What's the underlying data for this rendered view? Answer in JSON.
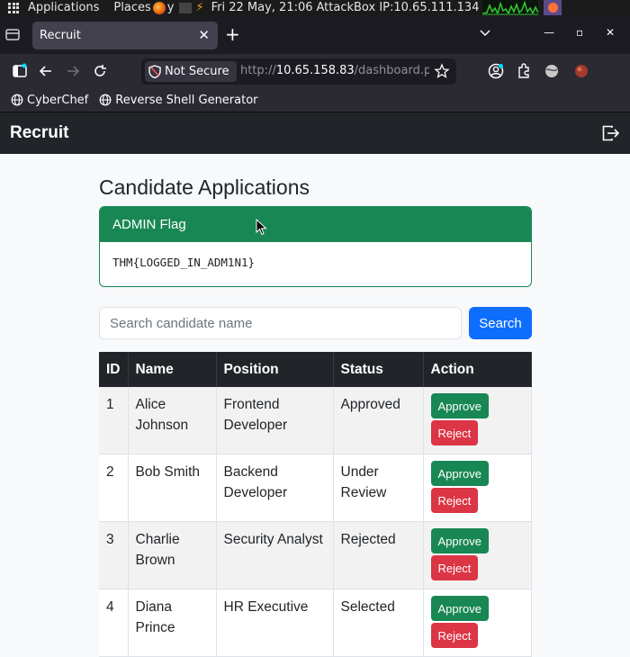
{
  "os_bar": {
    "applications_label": "Applications",
    "places_label": "Places",
    "firefox_fragment": "y",
    "clock": "Fri 22 May, 21:06",
    "ip_label": "AttackBox IP:10.65.111.134"
  },
  "browser": {
    "tab_title": "Recruit",
    "security_label": "Not Secure",
    "url_prefix": "http://",
    "url_host": "10.65.158.83",
    "url_path": "/dashboard.p",
    "bookmarks": [
      "CyberChef",
      "Reverse Shell Generator"
    ]
  },
  "site": {
    "brand": "Recruit",
    "page_title": "Candidate Applications",
    "flag_card": {
      "header": "ADMIN Flag",
      "value": "THM{LOGGED_IN_ADM1N1}"
    },
    "search": {
      "placeholder": "Search candidate name",
      "button_label": "Search"
    },
    "table": {
      "headers": [
        "ID",
        "Name",
        "Position",
        "Status",
        "Action"
      ],
      "rows": [
        {
          "id": "1",
          "name": "Alice Johnson",
          "position": "Frontend Developer",
          "status": "Approved"
        },
        {
          "id": "2",
          "name": "Bob Smith",
          "position": "Backend Developer",
          "status": "Under Review"
        },
        {
          "id": "3",
          "name": "Charlie Brown",
          "position": "Security Analyst",
          "status": "Rejected"
        },
        {
          "id": "4",
          "name": "Diana Prince",
          "position": "HR Executive",
          "status": "Selected"
        }
      ],
      "approve_label": "Approve",
      "reject_label": "Reject"
    }
  },
  "colors": {
    "navbar": "#212529",
    "success": "#198754",
    "primary": "#0d6efd",
    "danger": "#dc3545"
  }
}
